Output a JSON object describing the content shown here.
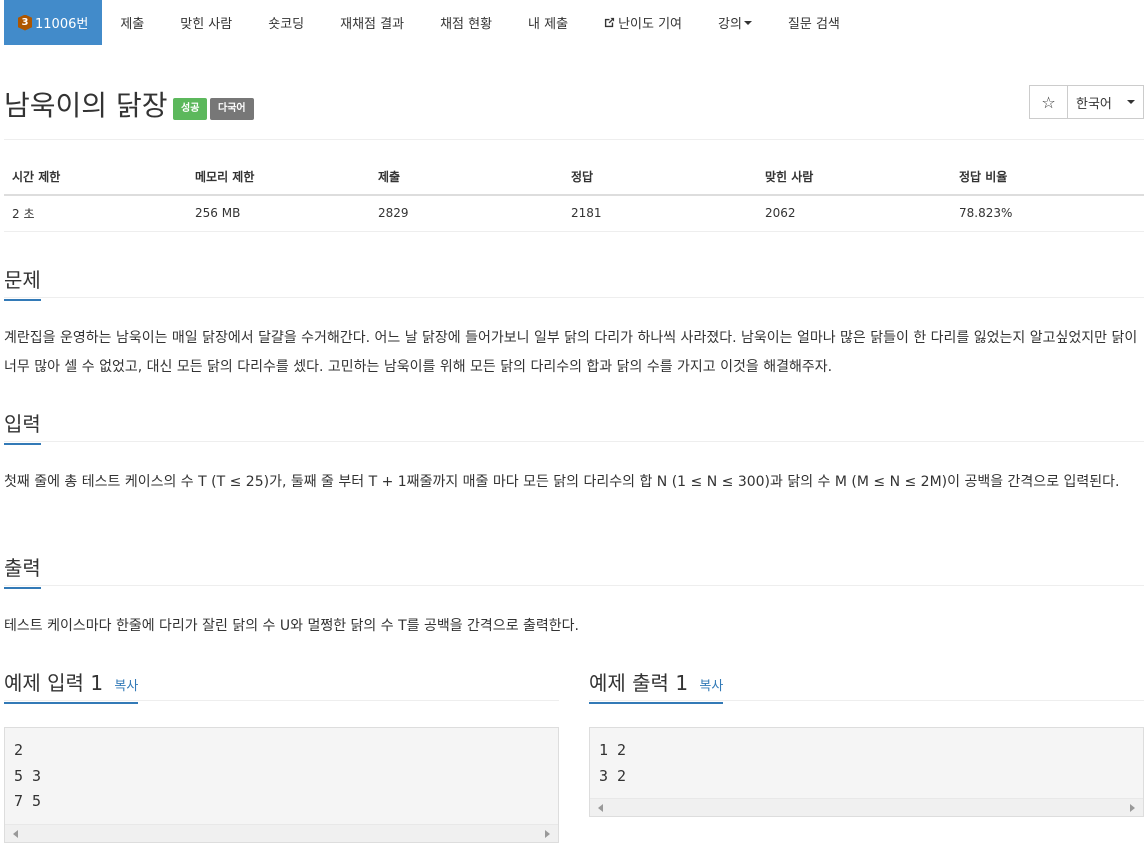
{
  "nav": {
    "tier": "3",
    "problem_number": "11006번",
    "items": [
      "제출",
      "맞힌 사람",
      "숏코딩",
      "재채점 결과",
      "채점 현황",
      "내 제출",
      "난이도 기여",
      "강의",
      "질문 검색"
    ]
  },
  "title": {
    "text": "남욱이의 닭장",
    "badge_success": "성공",
    "badge_lang": "다국어",
    "star": "☆",
    "language": "한국어"
  },
  "info": {
    "headers": [
      "시간 제한",
      "메모리 제한",
      "제출",
      "정답",
      "맞힌 사람",
      "정답 비율"
    ],
    "values": [
      "2 초",
      "256 MB",
      "2829",
      "2181",
      "2062",
      "78.823%"
    ]
  },
  "problem": {
    "heading": "문제",
    "body": "계란집을 운영하는 남욱이는 매일 닭장에서 달걀을 수거해간다. 어느 날 닭장에 들어가보니 일부 닭의 다리가 하나씩 사라졌다. 남욱이는 얼마나 많은 닭들이 한 다리를 잃었는지 알고싶었지만 닭이 너무 많아 셀 수 없었고, 대신 모든 닭의 다리수를 셌다. 고민하는 남욱이를 위해 모든 닭의 다리수의 합과 닭의 수를 가지고 이것을 해결해주자."
  },
  "input": {
    "heading": "입력",
    "body": "첫째 줄에 총 테스트 케이스의 수 T (T ≤ 25)가, 둘째 줄 부터 T + 1째줄까지 매줄 마다 모든 닭의 다리수의 합 N (1 ≤ N ≤ 300)과 닭의 수 M (M ≤ N ≤ 2M)이 공백을 간격으로 입력된다."
  },
  "output": {
    "heading": "출력",
    "body": "테스트 케이스마다 한줄에 다리가 잘린 닭의 수 U와 멀쩡한 닭의 수 T를 공백을 간격으로 출력한다."
  },
  "samples": {
    "input_heading": "예제 입력 1",
    "output_heading": "예제 출력 1",
    "copy_label": "복사",
    "input_lines": [
      "2",
      "5 3",
      "7 5"
    ],
    "output_lines": [
      "1 2",
      "3 2"
    ]
  }
}
